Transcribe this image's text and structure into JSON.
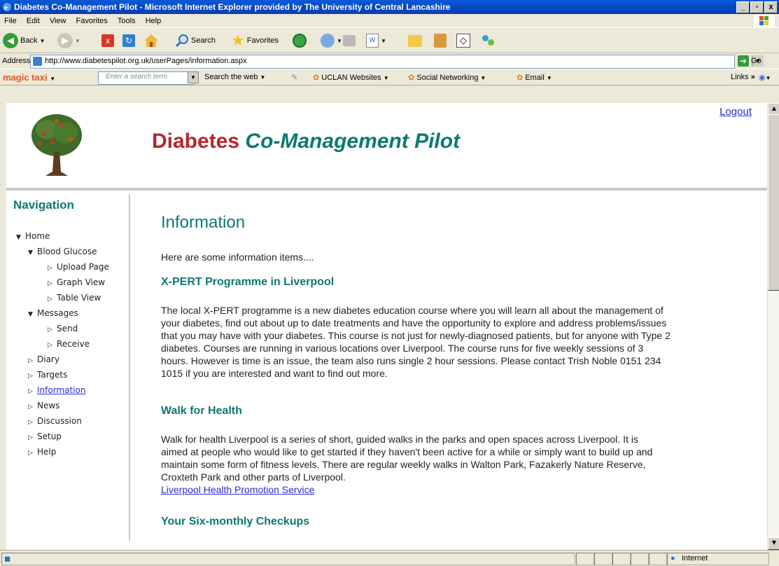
{
  "window": {
    "title": "Diabetes Co-Management Pilot - Microsoft Internet Explorer provided by The University of Central Lancashire",
    "min": "_",
    "max": "▫",
    "close": "x"
  },
  "menu": [
    "File",
    "Edit",
    "View",
    "Favorites",
    "Tools",
    "Help"
  ],
  "toolbar": {
    "back": "Back",
    "search": "Search",
    "favorites": "Favorites"
  },
  "address": {
    "label": "Address",
    "url": "http://www.diabetespilot.org.uk/userPages/information.aspx",
    "go": "Go"
  },
  "links_bar": {
    "magic": "magic taxi",
    "search_placeholder": "Enter a search term",
    "search_web": "Search the web",
    "uclan": "UCLAN Websites",
    "social": "Social Networking",
    "email": "Email",
    "links": "Links"
  },
  "page": {
    "brand_word1": "Diabetes",
    "brand_word2": "Co-Management Pilot",
    "logout": "Logout",
    "nav_title": "Navigation",
    "nav": [
      {
        "label": "Home",
        "state": "expanded"
      },
      {
        "label": "Blood Glucose",
        "state": "expanded"
      },
      {
        "label": "Upload Page",
        "state": "collapsed"
      },
      {
        "label": "Graph View",
        "state": "collapsed"
      },
      {
        "label": "Table View",
        "state": "collapsed"
      },
      {
        "label": "Messages",
        "state": "expanded"
      },
      {
        "label": "Send",
        "state": "collapsed"
      },
      {
        "label": "Receive",
        "state": "collapsed"
      },
      {
        "label": "Diary",
        "state": "collapsed"
      },
      {
        "label": "Targets",
        "state": "collapsed"
      },
      {
        "label": "Information",
        "state": "collapsed"
      },
      {
        "label": "News",
        "state": "collapsed"
      },
      {
        "label": "Discussion",
        "state": "collapsed"
      },
      {
        "label": "Setup",
        "state": "collapsed"
      },
      {
        "label": "Help",
        "state": "collapsed"
      }
    ],
    "heading": "Information",
    "intro": "Here are some information items....",
    "sections": [
      {
        "title": "X-PERT Programme in Liverpool",
        "lines": [
          "The local X-PERT programme is a new diabetes education course where you will learn all about the management of",
          "your diabetes, find out about up to date treatments and have the opportunity to explore and address problems/issues",
          "that you may have with your diabetes. This course is not just for newly-diagnosed patients, but for anyone with Type 2",
          "diabetes. Courses are running in various locations over Liverpool. The course runs for five weekly sessions of 3",
          "hours. However is time is an issue, the team also runs single 2 hour sessions. Please contact Trish Noble 0151 234",
          "1015 if you are interested and want to find out more."
        ]
      },
      {
        "title": "Walk for Health",
        "lines": [
          "Walk for health Liverpool is a series of short, guided walks in the parks and open spaces across Liverpool. It is",
          "aimed at people who would like to get started if they haven't been active for a while or simply want to build up and",
          "maintain some form of fitness levels. There are regular weekly walks in Walton Park, Fazakerly Nature Reserve,",
          "Croxteth Park and other parts of Liverpool."
        ],
        "link": "Liverpool Health Promotion Service"
      },
      {
        "title": "Your Six-monthly Checkups"
      }
    ]
  },
  "status": {
    "zone": "Internet"
  },
  "colors": {
    "brand_red": "#b4282c",
    "brand_teal": "#0c7873",
    "link": "#2a2ad6"
  }
}
